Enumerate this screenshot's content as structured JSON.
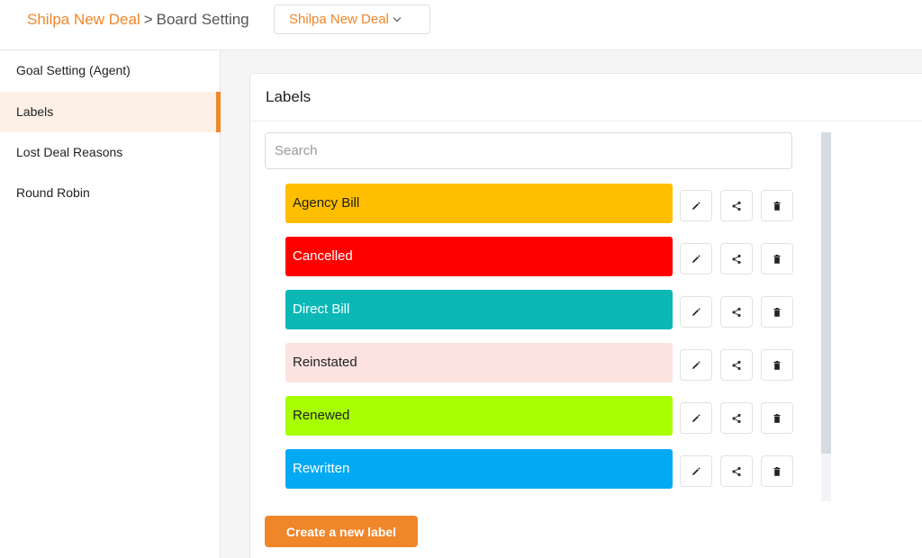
{
  "breadcrumb": {
    "link": "Shilpa New Deal",
    "separator": ">",
    "current": "Board Setting"
  },
  "board_select": {
    "value": "Shilpa New Deal"
  },
  "sidebar": {
    "active_color": "#f0862a",
    "items": [
      {
        "label": "Goal Setting (Agent)",
        "active": false
      },
      {
        "label": "Labels",
        "active": true
      },
      {
        "label": "Lost Deal Reasons",
        "active": false
      },
      {
        "label": "Round Robin",
        "active": false
      }
    ]
  },
  "panel": {
    "title": "Labels"
  },
  "search": {
    "placeholder": "Search",
    "value": ""
  },
  "labels": [
    {
      "name": "Agency Bill",
      "bg": "#ffbf00",
      "text_color": "#1e1e1e"
    },
    {
      "name": "Cancelled",
      "bg": "#ff0000",
      "text_color": "#ffffff"
    },
    {
      "name": "Direct Bill",
      "bg": "#0cb8b6",
      "text_color": "#ffffff"
    },
    {
      "name": "Reinstated",
      "bg": "#fde3df",
      "text_color": "#222222"
    },
    {
      "name": "Renewed",
      "bg": "#a8ff04",
      "text_color": "#1e1e1e"
    },
    {
      "name": "Rewritten",
      "bg": "#04a9f4",
      "text_color": "#ffffff"
    }
  ],
  "row_actions": [
    "pencil-icon",
    "share-icon",
    "trash-icon"
  ],
  "create_button": {
    "label": "Create a new label",
    "color": "#f0862a"
  }
}
